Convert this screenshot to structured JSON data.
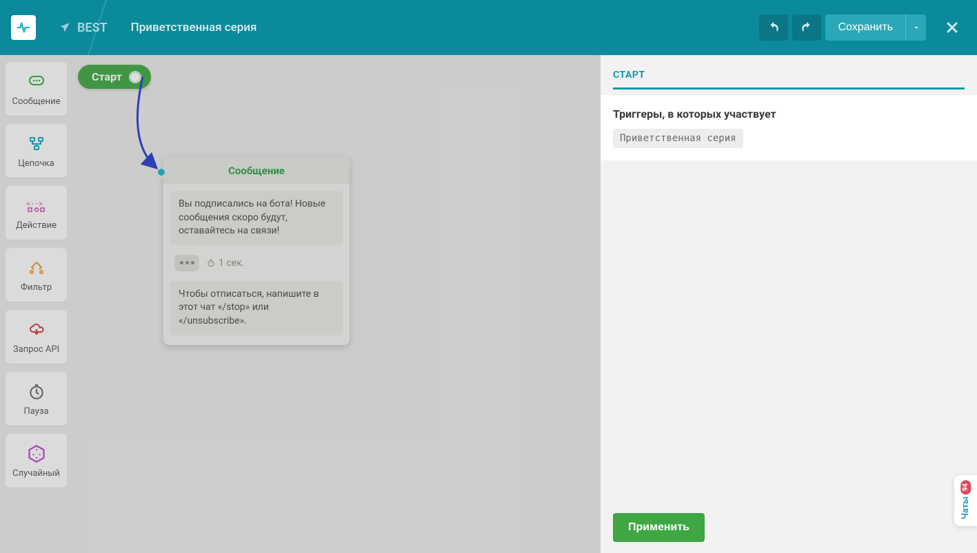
{
  "header": {
    "bot_name": "BEST",
    "flow_title": "Приветственная серия",
    "save_label": "Сохранить"
  },
  "toolbox": {
    "items": [
      {
        "label": "Сообщение",
        "color": "#3fa644"
      },
      {
        "label": "Цепочка",
        "color": "#17a7bb"
      },
      {
        "label": "Действие",
        "color": "#c44da6"
      },
      {
        "label": "Фильтр",
        "color": "#e69b2a"
      },
      {
        "label": "Запрос API",
        "color": "#d13a3a"
      },
      {
        "label": "Пауза",
        "color": "#6a6a6a"
      },
      {
        "label": "Случайный",
        "color": "#b94fc9"
      }
    ]
  },
  "canvas": {
    "start_label": "Старт",
    "message_card": {
      "title": "Сообщение",
      "bubble1": "Вы подписались на бота! Новые сообщения скоро будут, оставайтесь на связи!",
      "typing_delay": "1 сек.",
      "bubble2": "Чтобы отписаться, напишите в этот чат «/stop» или «/unsubscribe»."
    }
  },
  "right_panel": {
    "tab_label": "СТАРТ",
    "section_title": "Триггеры, в которых участвует",
    "trigger_chip": "Приветственная серия",
    "apply_label": "Применить"
  },
  "chat_tab": {
    "badge": "94",
    "label": "Чаты"
  }
}
